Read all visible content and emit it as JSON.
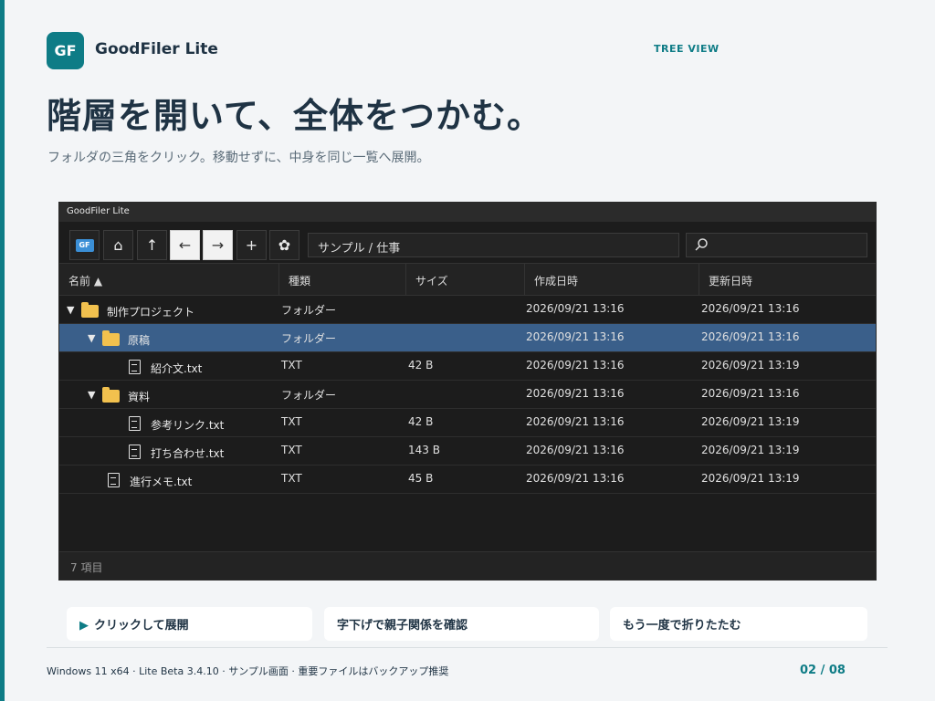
{
  "brand": {
    "logo_text": "GF",
    "app_name": "GoodFiler Lite",
    "section_tag": "TREE VIEW"
  },
  "headline": "階層を開いて、全体をつかむ。",
  "subline": "フォルダの三角をクリック。移動せずに、中身を同じ一覧へ展開。",
  "window": {
    "title": "GoodFiler Lite",
    "toolbar": {
      "logo_label": "GF",
      "home_icon": "⌂",
      "up_icon": "↑",
      "back_icon": "←",
      "forward_icon": "→",
      "new_icon": "+",
      "settings_icon": "✿",
      "address": "サンプル / 仕事",
      "search_placeholder": ""
    },
    "columns": {
      "name": "名前 ▲",
      "type": "種類",
      "size": "サイズ",
      "created": "作成日時",
      "modified": "更新日時"
    },
    "rows": [
      {
        "depth": 0,
        "kind": "folder",
        "expanded": true,
        "name": "制作プロジェクト",
        "type": "フォルダー",
        "size": "",
        "created": "2026/09/21 13:16",
        "modified": "2026/09/21 13:16",
        "selected": false
      },
      {
        "depth": 1,
        "kind": "folder",
        "expanded": true,
        "name": "原稿",
        "type": "フォルダー",
        "size": "",
        "created": "2026/09/21 13:16",
        "modified": "2026/09/21 13:16",
        "selected": true
      },
      {
        "depth": 2,
        "kind": "file",
        "expanded": false,
        "name": "紹介文.txt",
        "type": "TXT",
        "size": "42 B",
        "created": "2026/09/21 13:16",
        "modified": "2026/09/21 13:19",
        "selected": false
      },
      {
        "depth": 1,
        "kind": "folder",
        "expanded": true,
        "name": "資料",
        "type": "フォルダー",
        "size": "",
        "created": "2026/09/21 13:16",
        "modified": "2026/09/21 13:16",
        "selected": false
      },
      {
        "depth": 2,
        "kind": "file",
        "expanded": false,
        "name": "参考リンク.txt",
        "type": "TXT",
        "size": "42 B",
        "created": "2026/09/21 13:16",
        "modified": "2026/09/21 13:19",
        "selected": false
      },
      {
        "depth": 2,
        "kind": "file",
        "expanded": false,
        "name": "打ち合わせ.txt",
        "type": "TXT",
        "size": "143 B",
        "created": "2026/09/21 13:16",
        "modified": "2026/09/21 13:19",
        "selected": false
      },
      {
        "depth": 1,
        "kind": "file",
        "expanded": false,
        "name": "進行メモ.txt",
        "type": "TXT",
        "size": "45 B",
        "created": "2026/09/21 13:16",
        "modified": "2026/09/21 13:19",
        "selected": false
      }
    ],
    "status": "7 項目"
  },
  "hints": {
    "expand": "クリックして展開",
    "indent": "字下げで親子関係を確認",
    "collapse": "もう一度で折りたたむ",
    "expand_icon": "▶"
  },
  "footer": {
    "info": "Windows 11 x64 · Lite Beta 3.4.10 · サンプル画面 · 重要ファイルはバックアップ推奨",
    "page": "02 / 08"
  },
  "colors": {
    "accent": "#0e7c86",
    "selected_row": "#3a5f8a",
    "folder": "#f2c14e"
  }
}
